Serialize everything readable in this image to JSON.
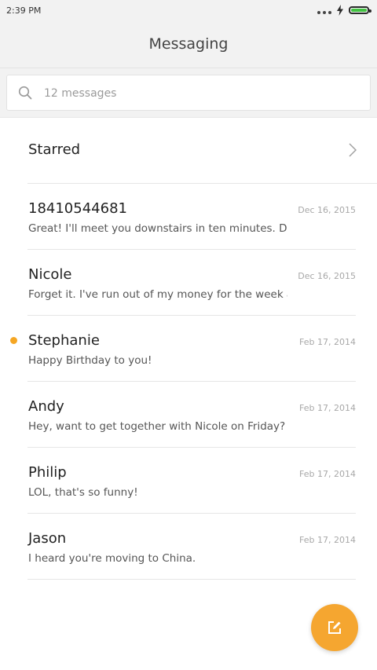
{
  "status_bar": {
    "time": "2:39 PM",
    "battery_level": 1.0,
    "battery_color": "#41c241"
  },
  "header": {
    "title": "Messaging"
  },
  "search": {
    "placeholder": "12 messages",
    "icon": "search-icon"
  },
  "starred": {
    "label": "Starred",
    "icon": "chevron-right-icon"
  },
  "threads": [
    {
      "sender": "18410544681",
      "date": "Dec 16, 2015",
      "preview": "Great! I'll meet you downstairs in ten minutes. Don't forge",
      "unread": false
    },
    {
      "sender": "Nicole",
      "date": "Dec 16, 2015",
      "preview": "Forget it. I've run out of my money for the week already.",
      "unread": false
    },
    {
      "sender": "Stephanie",
      "date": "Feb 17, 2014",
      "preview": "Happy Birthday to you!",
      "unread": true
    },
    {
      "sender": "Andy",
      "date": "Feb 17, 2014",
      "preview": "Hey, want to get together with Nicole on Friday?",
      "unread": false
    },
    {
      "sender": "Philip",
      "date": "Feb 17, 2014",
      "preview": "LOL, that's so funny!",
      "unread": false
    },
    {
      "sender": "Jason",
      "date": "Feb 17, 2014",
      "preview": "I heard you're moving to China.",
      "unread": false
    }
  ],
  "fab": {
    "icon": "compose-icon",
    "color": "#f5a630"
  },
  "colors": {
    "accent": "#f5a623",
    "unread_dot": "#f5a623"
  }
}
